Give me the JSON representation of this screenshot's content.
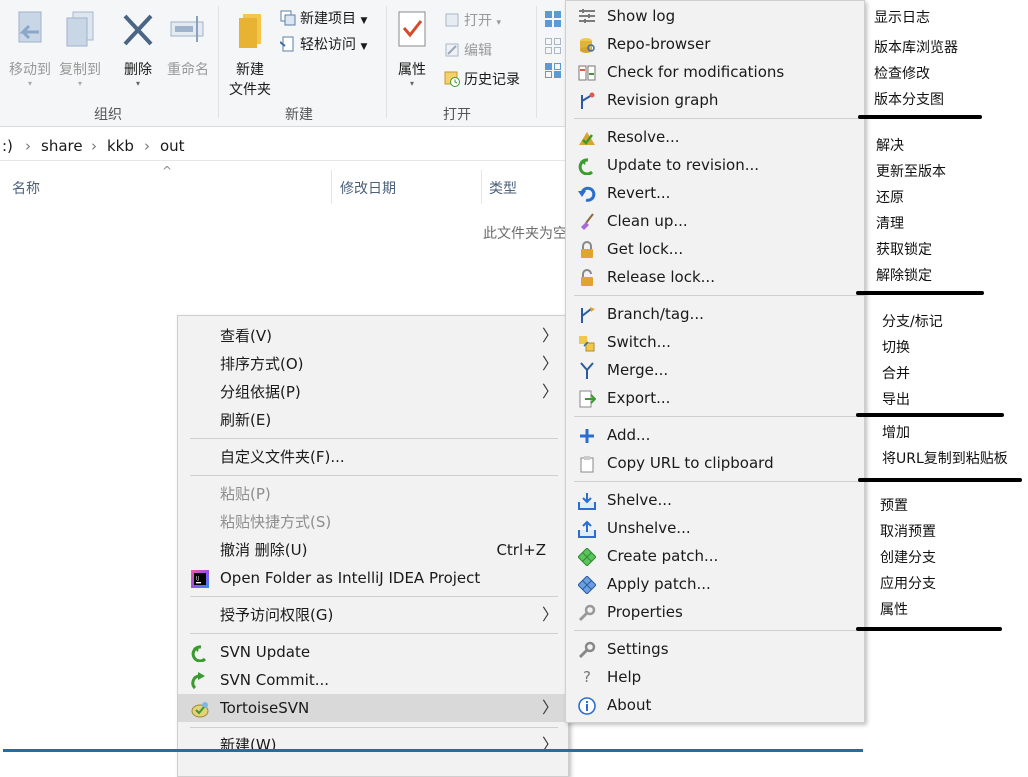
{
  "ribbon": {
    "organize": {
      "move_to": "移动到",
      "copy_to": "复制到",
      "delete": "删除",
      "rename": "重命名",
      "group": "组织"
    },
    "new": {
      "new_folder": "新建\n文件夹",
      "new_item": "新建项目",
      "easy_access": "轻松访问",
      "group": "新建"
    },
    "open": {
      "properties": "属性",
      "open": "打开",
      "edit": "编辑",
      "history": "历史记录",
      "group": "打开"
    }
  },
  "address": {
    "drive": ":)",
    "crumbs": [
      "share",
      "kkb",
      "out"
    ]
  },
  "columns": {
    "name": "名称",
    "modified": "修改日期",
    "type": "类型"
  },
  "empty_message": "此文件夹为空",
  "context_menu": {
    "view": "查看(V)",
    "sort_by": "排序方式(O)",
    "group_by": "分组依据(P)",
    "refresh": "刷新(E)",
    "customize": "自定义文件夹(F)...",
    "paste": "粘贴(P)",
    "paste_shortcut": "粘贴快捷方式(S)",
    "undo_delete": "撤消 删除(U)",
    "undo_shortcut": "Ctrl+Z",
    "intellij": "Open Folder as IntelliJ IDEA Project",
    "grant_access": "授予访问权限(G)",
    "svn_update": "SVN Update",
    "svn_commit": "SVN Commit...",
    "tortoise": "TortoiseSVN",
    "new": "新建(W)"
  },
  "svn_menu": {
    "show_log": "Show log",
    "repo_browser": "Repo-browser",
    "check_mod": "Check for modifications",
    "rev_graph": "Revision graph",
    "resolve": "Resolve...",
    "update_rev": "Update to revision...",
    "revert": "Revert...",
    "cleanup": "Clean up...",
    "get_lock": "Get lock...",
    "release_lock": "Release lock...",
    "branch_tag": "Branch/tag...",
    "switch": "Switch...",
    "merge": "Merge...",
    "export": "Export...",
    "add": "Add...",
    "copy_url": "Copy URL to clipboard",
    "shelve": "Shelve...",
    "unshelve": "Unshelve...",
    "create_patch": "Create patch...",
    "apply_patch": "Apply patch...",
    "properties": "Properties",
    "settings": "Settings",
    "help": "Help",
    "about": "About"
  },
  "annotations": {
    "show_log": "显示日志",
    "repo_browser": "版本库浏览器",
    "check_mod": "检查修改",
    "rev_graph": "版本分支图",
    "resolve": "解决",
    "update_rev": "更新至版本",
    "revert": "还原",
    "cleanup": "清理",
    "get_lock": "获取锁定",
    "release_lock": "解除锁定",
    "branch_tag": "分支/标记",
    "switch": "切换",
    "merge": "合并",
    "export": "导出",
    "add": "增加",
    "copy_url": "将URL复制到粘贴板",
    "shelve": "预置",
    "unshelve": "取消预置",
    "create_patch": "创建分支",
    "apply_patch": "应用分支",
    "properties": "属性"
  },
  "colors": {
    "accent_blue": "#1c6fa8",
    "menu_bg": "#f2f2f2",
    "highlight": "#d9d9d9",
    "svn_green": "#3a9b2e"
  }
}
